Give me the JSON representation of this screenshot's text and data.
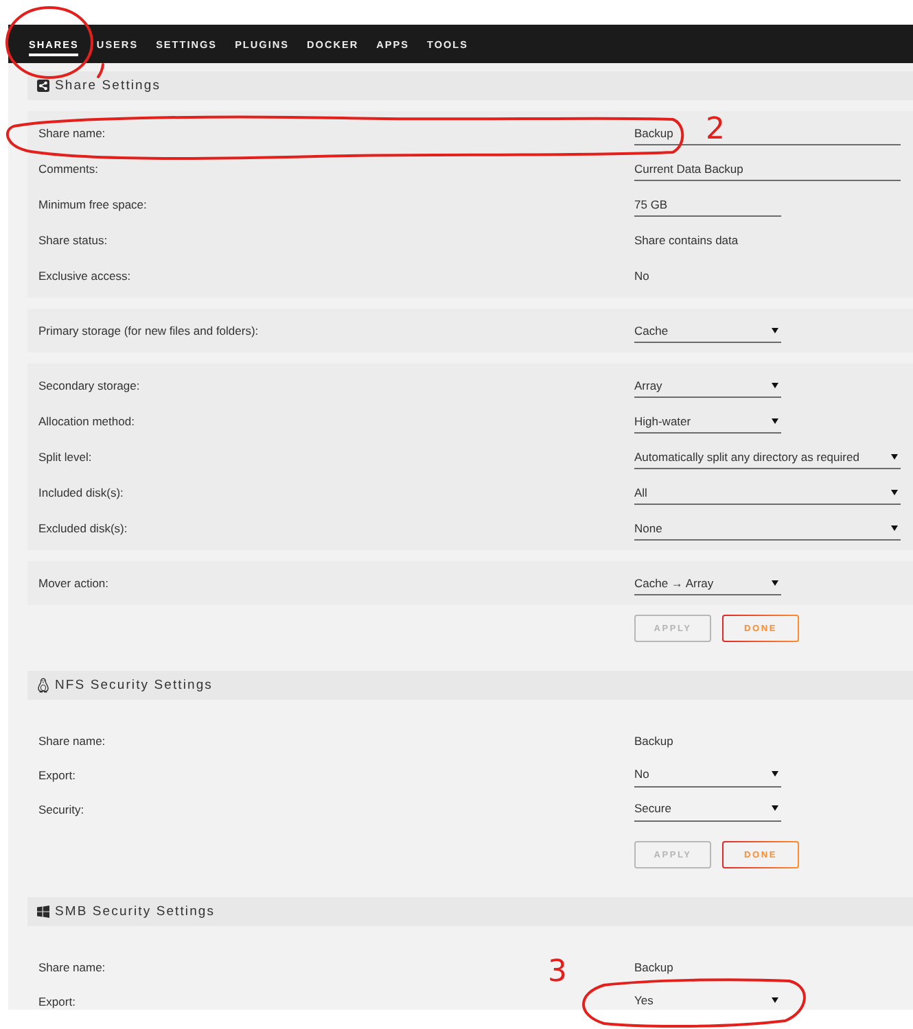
{
  "nav": {
    "tabs": [
      {
        "label": "SHARES",
        "selected": true
      },
      {
        "label": "USERS",
        "selected": false
      },
      {
        "label": "SETTINGS",
        "selected": false
      },
      {
        "label": "PLUGINS",
        "selected": false
      },
      {
        "label": "DOCKER",
        "selected": false
      },
      {
        "label": "APPS",
        "selected": false
      },
      {
        "label": "TOOLS",
        "selected": false
      }
    ]
  },
  "sections": [
    {
      "kind": "share",
      "title": "Share Settings",
      "groups": [
        {
          "shaded": true,
          "rows": [
            {
              "label": "Share name:",
              "kind": "input",
              "value": "Backup"
            },
            {
              "label": "Comments:",
              "kind": "input",
              "value": "Current Data Backup"
            },
            {
              "label": "Minimum free space:",
              "kind": "short-input",
              "value": "75 GB"
            },
            {
              "label": "Share status:",
              "kind": "text",
              "value": "Share contains data"
            },
            {
              "label": "Exclusive access:",
              "kind": "text",
              "value": "No"
            }
          ]
        },
        {
          "shaded": true,
          "rows": [
            {
              "label": "Primary storage (for new files and folders):",
              "kind": "select",
              "value": "Cache"
            }
          ]
        },
        {
          "shaded": true,
          "rows": [
            {
              "label": "Secondary storage:",
              "kind": "select",
              "value": "Array"
            },
            {
              "label": "Allocation method:",
              "kind": "select",
              "value": "High-water"
            },
            {
              "label": "Split level:",
              "kind": "wide-select",
              "value": "Automatically split any directory as required"
            },
            {
              "label": "Included disk(s):",
              "kind": "wide-select",
              "value": "All"
            },
            {
              "label": "Excluded disk(s):",
              "kind": "wide-select",
              "value": "None"
            }
          ]
        },
        {
          "shaded": true,
          "rows": [
            {
              "label": "Mover action:",
              "kind": "select",
              "value": "Cache → Array"
            }
          ]
        }
      ],
      "buttons": [
        {
          "label": "APPLY",
          "disabled": true
        },
        {
          "label": "DONE",
          "disabled": false
        }
      ]
    },
    {
      "kind": "nfs",
      "title": "NFS Security Settings",
      "groups": [
        {
          "shaded": false,
          "rows": [
            {
              "label": "Share name:",
              "kind": "text",
              "value": "Backup"
            },
            {
              "label": "Export:",
              "kind": "select",
              "value": "No"
            },
            {
              "label": "Security:",
              "kind": "select",
              "value": "Secure"
            }
          ]
        }
      ],
      "buttons": [
        {
          "label": "APPLY",
          "disabled": true
        },
        {
          "label": "DONE",
          "disabled": false
        }
      ]
    },
    {
      "kind": "smb",
      "title": "SMB Security Settings",
      "groups": [
        {
          "shaded": false,
          "rows": [
            {
              "label": "Share name:",
              "kind": "text",
              "value": "Backup"
            },
            {
              "label": "Export:",
              "kind": "select",
              "value": "Yes"
            }
          ]
        }
      ]
    }
  ],
  "annotations": [
    {
      "kind": "ellipse"
    },
    {
      "kind": "stroke"
    },
    {
      "kind": "ellipse"
    },
    {
      "kind": "number",
      "text": "2"
    },
    {
      "kind": "number",
      "text": "3"
    },
    {
      "kind": "ellipse"
    }
  ]
}
